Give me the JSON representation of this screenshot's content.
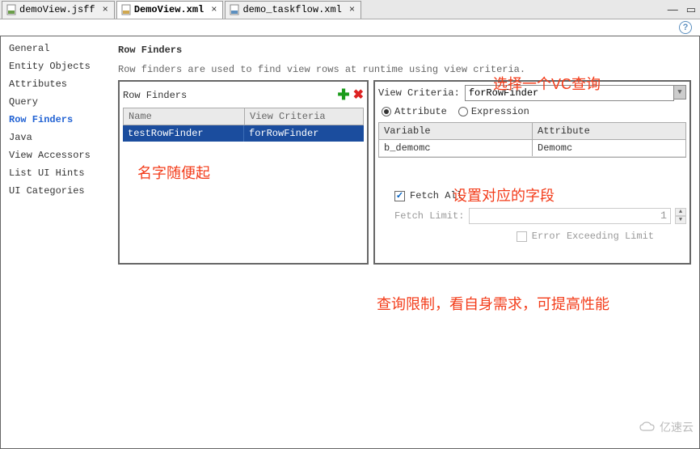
{
  "tabs": [
    {
      "label": "demoView.jsff"
    },
    {
      "label": "DemoView.xml",
      "active": true,
      "bold": true
    },
    {
      "label": "demo_taskflow.xml"
    }
  ],
  "sidebar": {
    "items": [
      {
        "label": "General"
      },
      {
        "label": "Entity Objects"
      },
      {
        "label": "Attributes"
      },
      {
        "label": "Query"
      },
      {
        "label": "Row Finders",
        "selected": true
      },
      {
        "label": "Java"
      },
      {
        "label": "View Accessors"
      },
      {
        "label": "List UI Hints"
      },
      {
        "label": "UI Categories"
      }
    ]
  },
  "main": {
    "title": "Row Finders",
    "desc": "Row finders are used to find view rows at runtime using view criteria."
  },
  "leftBox": {
    "title": "Row Finders",
    "columns": {
      "name": "Name",
      "vc": "View Criteria"
    },
    "rows": [
      {
        "name": "testRowFinder",
        "vc": "forRowFinder"
      }
    ]
  },
  "rightBox": {
    "vcLabel": "View Criteria:",
    "vcValue": "forRowFinder",
    "radios": {
      "attribute": "Attribute",
      "expression": "Expression"
    },
    "attrTable": {
      "headers": {
        "var": "Variable",
        "attr": "Attribute"
      },
      "rows": [
        {
          "var": "b_demomc",
          "attr": "Demomc"
        }
      ]
    },
    "fetchAll": "Fetch All",
    "fetchLimit": {
      "label": "Fetch Limit:",
      "value": "1"
    },
    "errorExceed": "Error Exceeding Limit"
  },
  "annotations": {
    "a1": "选择一个VC查询",
    "a2": "名字随便起",
    "a3": "设置对应的字段",
    "a4": "查询限制，看自身需求，可提高性能"
  },
  "watermark": "亿速云"
}
